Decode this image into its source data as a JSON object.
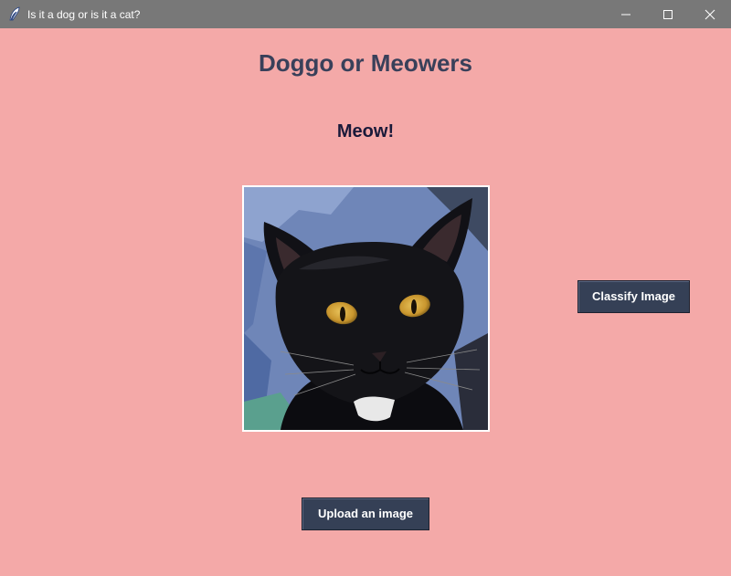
{
  "window": {
    "title": "Is it a dog or is it a cat?",
    "icon": "feather-icon",
    "controls": [
      "minimize-icon",
      "maximize-icon",
      "close-icon"
    ]
  },
  "app": {
    "heading": "Doggo or Meowers",
    "result": "Meow!",
    "image_subject": "black-cat-photo",
    "classify_label": "Classify Image",
    "upload_label": "Upload an image"
  },
  "colors": {
    "background": "#f4a9a8",
    "titlebar": "#787878",
    "heading": "#39405a",
    "button": "#354056",
    "button_text": "#ffffff"
  }
}
